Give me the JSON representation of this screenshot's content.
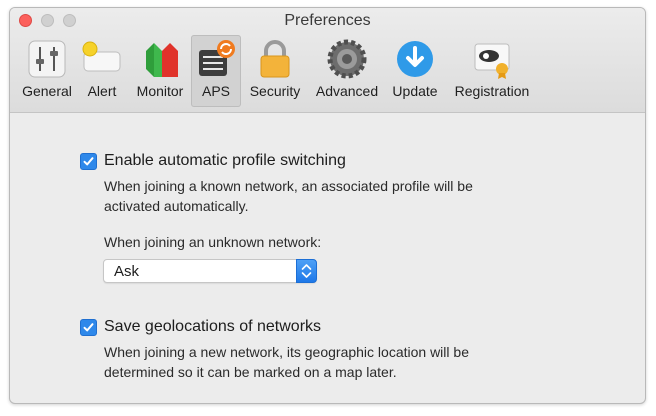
{
  "window": {
    "title": "Preferences"
  },
  "toolbar": {
    "items": [
      {
        "label": "General",
        "icon": "sliders-icon"
      },
      {
        "label": "Alert",
        "icon": "notification-banner-icon"
      },
      {
        "label": "Monitor",
        "icon": "traffic-monitor-icon"
      },
      {
        "label": "APS",
        "icon": "aps-profile-switch-icon",
        "selected": true
      },
      {
        "label": "Security",
        "icon": "padlock-icon"
      },
      {
        "label": "Advanced",
        "icon": "gear-icon"
      },
      {
        "label": "Update",
        "icon": "download-arrow-icon"
      },
      {
        "label": "Registration",
        "icon": "license-certificate-icon"
      }
    ]
  },
  "aps": {
    "auto_switch": {
      "label": "Enable automatic profile switching",
      "checked": true,
      "description": "When joining a known network, an associated profile will be activated automatically."
    },
    "unknown_network": {
      "label": "When joining an unknown network:",
      "selected": "Ask"
    },
    "geolocation": {
      "label": "Save geolocations of networks",
      "checked": true,
      "description": "When joining a new network, its geographic location will be determined so it can be marked on a map later."
    }
  },
  "colors": {
    "accent": "#2e88ea",
    "close_button": "#fc605c",
    "window_bg": "#ececec"
  }
}
